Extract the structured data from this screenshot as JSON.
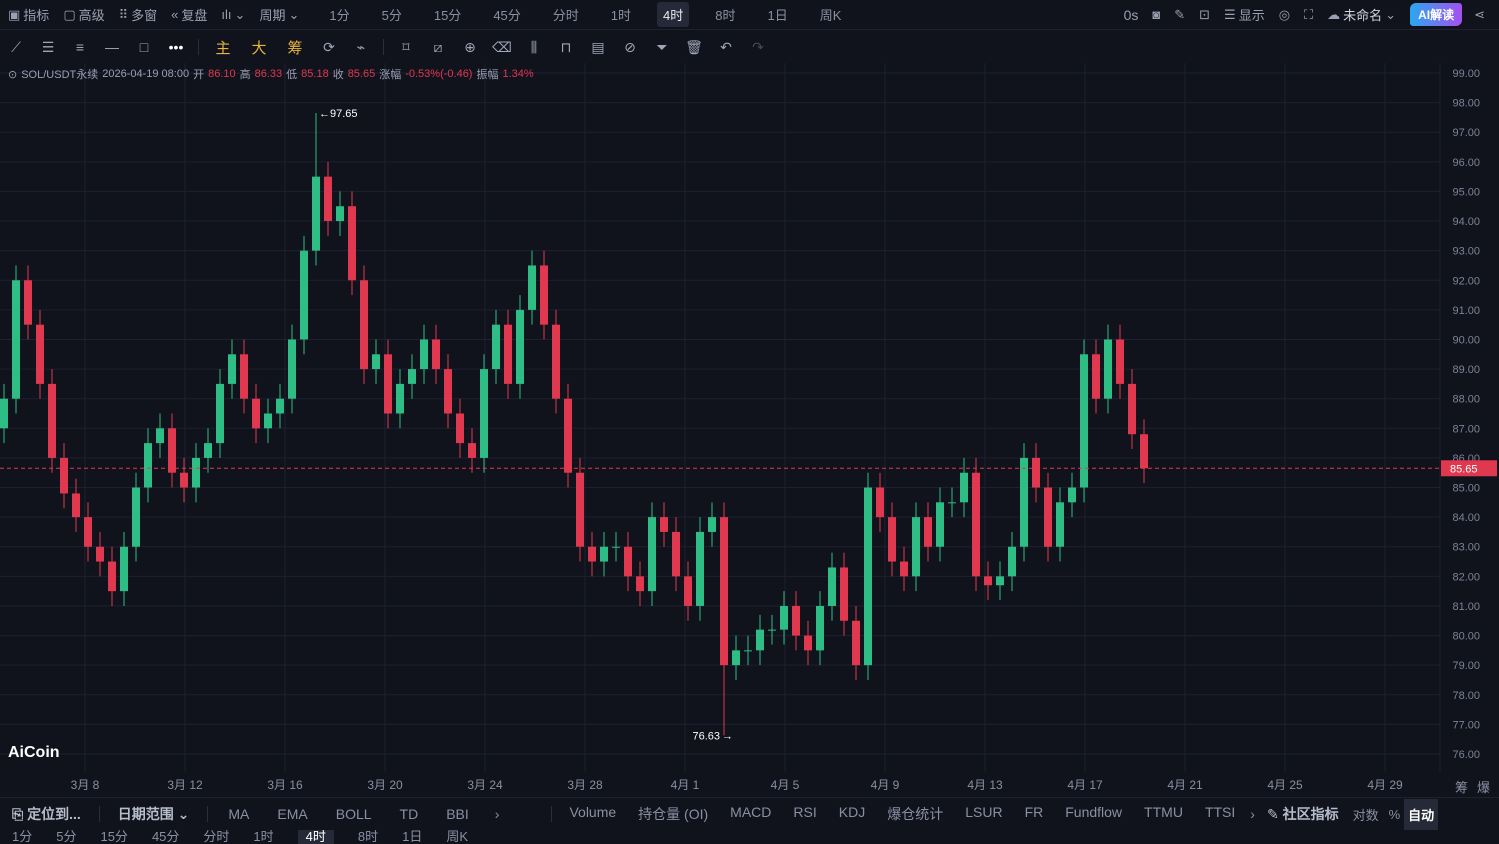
{
  "topbar": {
    "indicators": "指标",
    "advanced": "高级",
    "multi_window": "多窗",
    "replay": "复盘",
    "period": "周期",
    "periods": [
      "1分",
      "5分",
      "15分",
      "45分",
      "分时",
      "1时",
      "4时",
      "8时",
      "1日",
      "周K"
    ],
    "active_period": "4时",
    "countdown": "0s",
    "display": "显示",
    "layout_name": "未命名",
    "ai_label": "AI解读"
  },
  "toolbar": {
    "main": "主",
    "big": "大",
    "chips": "筹"
  },
  "info": {
    "symbol": "SOL/USDT永续",
    "time": "2026-04-19 08:00",
    "open_label": "开",
    "open": "86.10",
    "high_label": "高",
    "high": "86.33",
    "low_label": "低",
    "low": "85.18",
    "close_label": "收",
    "close": "85.65",
    "change_label": "涨幅",
    "change": "-0.53%(-0.46)",
    "amp_label": "振幅",
    "amp": "1.34%"
  },
  "logo": "AiCoin",
  "chart_data": {
    "type": "candlestick",
    "symbol": "SOL/USDT永续",
    "ylim": [
      76,
      99
    ],
    "y_ticks": [
      "99.00",
      "98.00",
      "97.00",
      "96.00",
      "95.00",
      "94.00",
      "93.00",
      "92.00",
      "91.00",
      "90.00",
      "89.00",
      "88.00",
      "87.00",
      "86.00",
      "85.00",
      "84.00",
      "83.00",
      "82.00",
      "81.00",
      "80.00",
      "79.00",
      "78.00",
      "77.00",
      "76.00"
    ],
    "x_ticks": [
      "3月 8",
      "3月 12",
      "3月 16",
      "3月 20",
      "3月 24",
      "3月 28",
      "4月 1",
      "4月 5",
      "4月 9",
      "4月 13",
      "4月 17",
      "4月 21",
      "4月 25",
      "4月 29"
    ],
    "first_open": 87,
    "closes": [
      88,
      92,
      90.5,
      88.5,
      86,
      84.8,
      84,
      83,
      82.5,
      81.5,
      83,
      85,
      86.5,
      87,
      85.5,
      85,
      86,
      86.5,
      88.5,
      89.5,
      88,
      87,
      87.5,
      88,
      90,
      93,
      95.5,
      94,
      94.5,
      92,
      89,
      89.5,
      87.5,
      88.5,
      89,
      90,
      89,
      87.5,
      86.5,
      86,
      89,
      90.5,
      88.5,
      91,
      92.5,
      90.5,
      88,
      85.5,
      83,
      82.5,
      83,
      83,
      82,
      81.5,
      84,
      83.5,
      82,
      81,
      83.5,
      84,
      79,
      79.5,
      79.5,
      80.2,
      80.2,
      81,
      80,
      79.5,
      81,
      82.3,
      80.5,
      79,
      85,
      84,
      82.5,
      82,
      84,
      83,
      84.5,
      84.5,
      85.5,
      82,
      81.7,
      82,
      83,
      86,
      85,
      83,
      84.5,
      85,
      89.5,
      88,
      90,
      88.5,
      86.8,
      85.65
    ],
    "max_high": {
      "index": 26,
      "value": 97.65,
      "label": "97.65"
    },
    "min_low": {
      "index": 60,
      "value": 76.63,
      "label": "76.63"
    },
    "last_price": {
      "value": 85.65,
      "label": "85.65"
    },
    "up_color": "#2ebd85",
    "down_color": "#e0384f"
  },
  "axis_right": {
    "chips": "筹",
    "liq": "爆"
  },
  "bottom": {
    "locate": "定位到...",
    "date_range": "日期范围",
    "main_indicators": [
      "MA",
      "EMA",
      "BOLL",
      "TD",
      "BBI"
    ],
    "sub_indicators": [
      "Volume",
      "持仓量 (OI)",
      "MACD",
      "RSI",
      "KDJ",
      "爆仓统计",
      "LSUR",
      "FR",
      "Fundflow",
      "TTMU",
      "TTSI"
    ],
    "community": "社区指标",
    "log": "对数",
    "percent": "%",
    "auto": "自动"
  }
}
